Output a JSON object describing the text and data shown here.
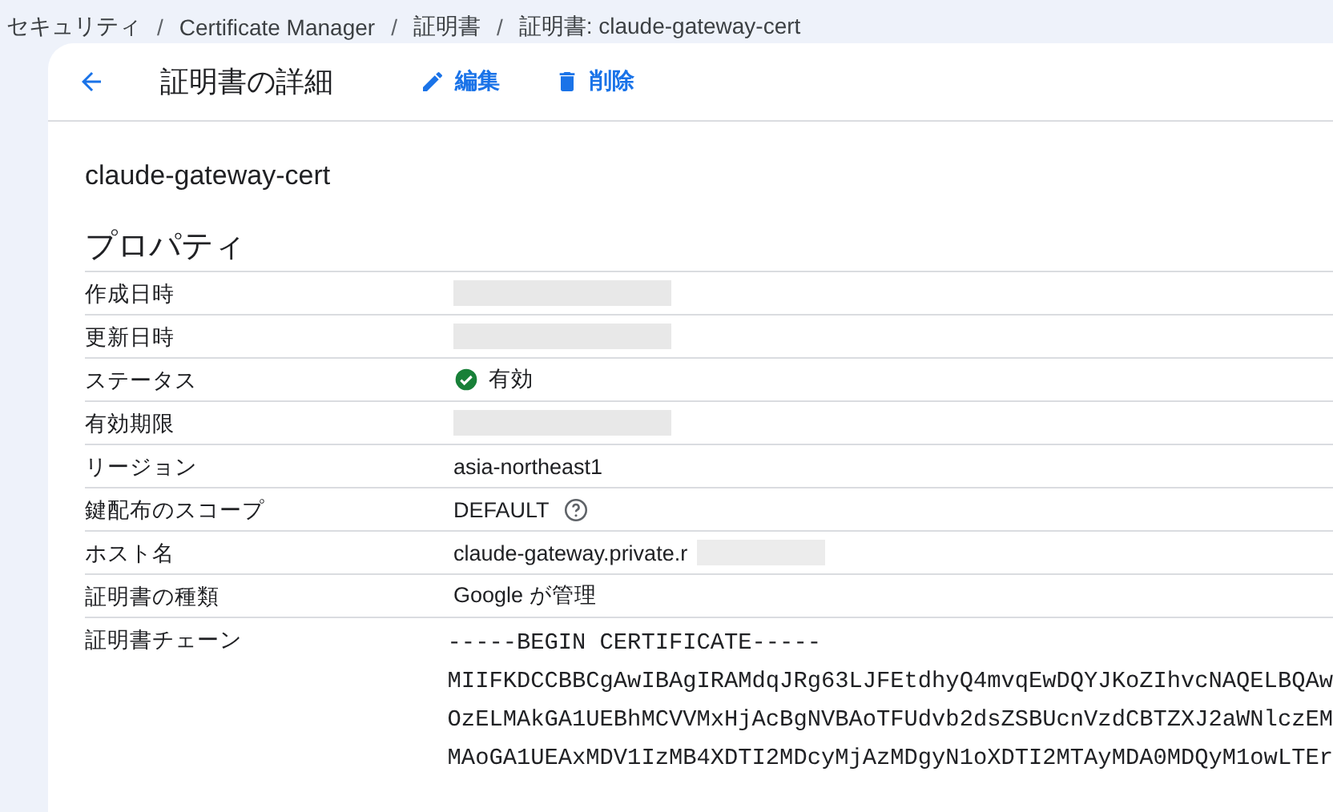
{
  "breadcrumb_separator": "/",
  "breadcrumb": [
    "セキュリティ",
    "Certificate Manager",
    "証明書",
    "証明書: claude-gateway-cert"
  ],
  "header": {
    "title": "証明書の詳細",
    "actions": [
      {
        "kind": "edit",
        "label": "編集"
      },
      {
        "kind": "delete",
        "label": "削除"
      }
    ]
  },
  "certificate_name": "claude-gateway-cert",
  "section_title": "プロパティ",
  "properties": [
    {
      "label": "作成日時",
      "kind": "redacted"
    },
    {
      "label": "更新日時",
      "kind": "redacted"
    },
    {
      "label": "ステータス",
      "kind": "status",
      "value": "有効"
    },
    {
      "label": "有効期限",
      "kind": "redacted"
    },
    {
      "label": "リージョン",
      "kind": "text",
      "value": "asia-northeast1"
    },
    {
      "label": "鍵配布のスコープ",
      "kind": "help",
      "value": "DEFAULT"
    },
    {
      "label": "ホスト名",
      "kind": "partial-redacted",
      "value": "claude-gateway.private.r"
    },
    {
      "label": "証明書の種類",
      "kind": "text",
      "value": "Google が管理"
    },
    {
      "label": "証明書チェーン",
      "kind": "code",
      "lines": [
        "-----BEGIN CERTIFICATE-----",
        "MIIFKDCCBBCgAwIBAgIRAMdqJRg63LJFEtdhyQ4mvqEwDQYJKoZIhvcNAQELBQAw",
        "OzELMAkGA1UEBhMCVVMxHjAcBgNVBAoTFUdvb2dsZSBUcnVzdCBTZXJ2aWNlczEM",
        "MAoGA1UEAxMDV1IzMB4XDTI2MDcyMjAzMDgyN1oXDTI2MTAyMDA0MDQyM1owLTEr"
      ]
    }
  ]
}
